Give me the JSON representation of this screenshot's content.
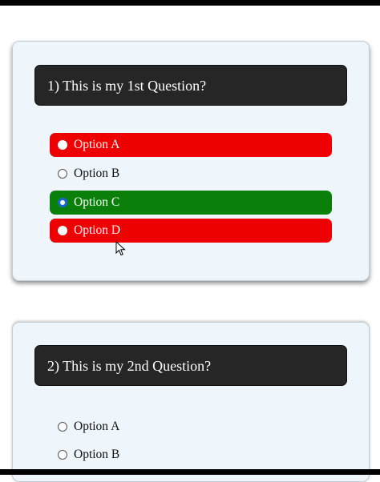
{
  "questions": [
    {
      "text": "1) This is my 1st Question?",
      "options": [
        {
          "label": "Option A",
          "state": "wrong",
          "color": "#ee0000"
        },
        {
          "label": "Option B",
          "state": "neutral"
        },
        {
          "label": "Option C",
          "state": "selected-correct",
          "color": "#0a800a"
        },
        {
          "label": "Option D",
          "state": "wrong",
          "color": "#ee0000"
        }
      ]
    },
    {
      "text": "2) This is my 2nd Question?",
      "options": [
        {
          "label": "Option A",
          "state": "neutral"
        },
        {
          "label": "Option B",
          "state": "neutral"
        }
      ]
    }
  ],
  "colors": {
    "question_header": "#262626",
    "card_background": "#eef5fb",
    "wrong": "#ee0000",
    "correct": "#0a800a",
    "selected_radio": "#1a66d9"
  },
  "cursor": "arrow-pointer-icon"
}
